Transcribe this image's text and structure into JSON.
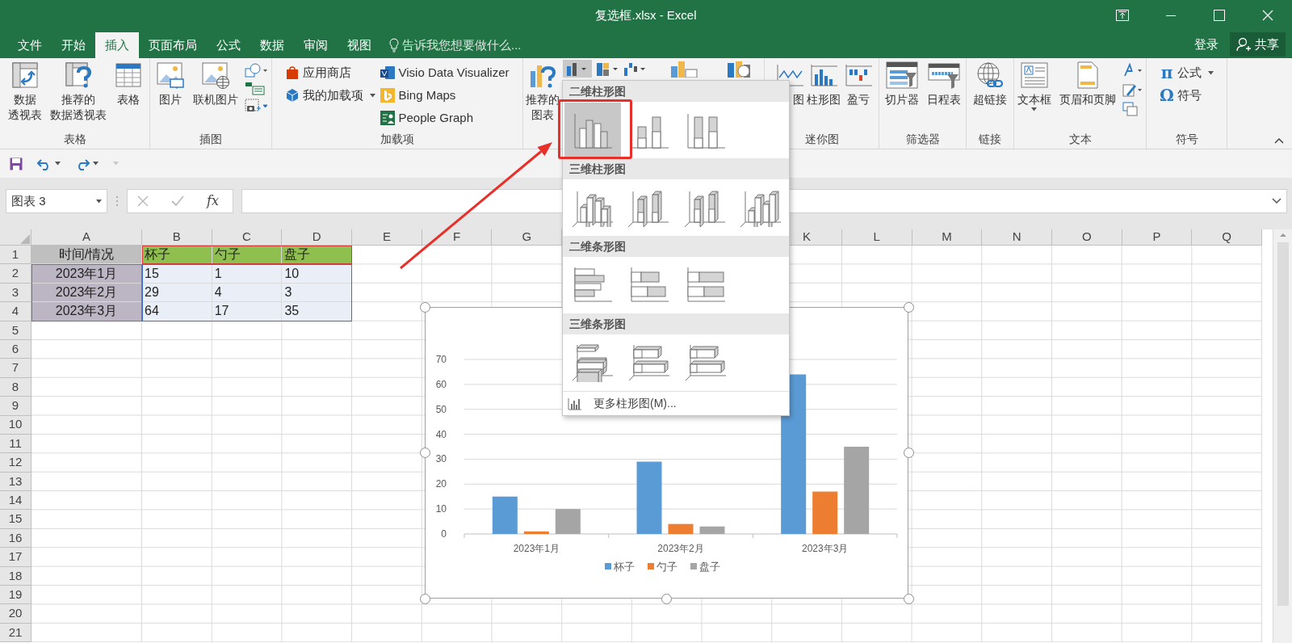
{
  "window": {
    "title": "复选框.xlsx - Excel"
  },
  "tabs": [
    {
      "label": "文件",
      "selected": false
    },
    {
      "label": "开始",
      "selected": false
    },
    {
      "label": "插入",
      "selected": true
    },
    {
      "label": "页面布局",
      "selected": false
    },
    {
      "label": "公式",
      "selected": false
    },
    {
      "label": "数据",
      "selected": false
    },
    {
      "label": "审阅",
      "selected": false
    },
    {
      "label": "视图",
      "selected": false
    }
  ],
  "tell_me": {
    "placeholder": "告诉我您想要做什么..."
  },
  "account": {
    "sign_in": "登录",
    "share": "共享"
  },
  "ribbon": {
    "groups": [
      {
        "label": "表格",
        "items": [
          {
            "kind": "large",
            "lines": [
              "数据",
              "透视表"
            ]
          },
          {
            "kind": "large",
            "lines": [
              "推荐的",
              "数据透视表"
            ]
          },
          {
            "kind": "large",
            "lines": [
              "表格"
            ]
          }
        ]
      },
      {
        "label": "插图",
        "items": [
          {
            "kind": "large",
            "lines": [
              "图片"
            ]
          },
          {
            "kind": "large",
            "lines": [
              "联机图片"
            ]
          },
          {
            "kind": "icons"
          }
        ]
      },
      {
        "label": "加载项",
        "items": [
          {
            "kind": "stack",
            "entries": [
              {
                "label": "应用商店",
                "dropdown": false
              },
              {
                "label": "我的加载项",
                "dropdown": true
              }
            ]
          },
          {
            "kind": "stack",
            "entries": [
              {
                "label": "Visio Data Visualizer",
                "dropdown": false
              },
              {
                "label": "Bing Maps",
                "dropdown": false
              },
              {
                "label": "People Graph",
                "dropdown": false
              }
            ]
          }
        ]
      },
      {
        "items": [
          {
            "kind": "large",
            "lines": [
              "推荐的",
              "图表"
            ]
          },
          {
            "kind": "icons"
          }
        ]
      },
      {
        "label": "迷你图",
        "items": [
          {
            "kind": "large",
            "lines": [
              "图"
            ]
          },
          {
            "kind": "large",
            "lines": [
              "柱形图"
            ]
          },
          {
            "kind": "large",
            "lines": [
              "盈亏"
            ]
          }
        ]
      },
      {
        "label": "筛选器",
        "items": [
          {
            "kind": "large",
            "lines": [
              "切片器"
            ]
          },
          {
            "kind": "large",
            "lines": [
              "日程表"
            ]
          }
        ]
      },
      {
        "label": "链接",
        "items": [
          {
            "kind": "large",
            "lines": [
              "超链接"
            ]
          }
        ]
      },
      {
        "label": "文本",
        "items": [
          {
            "kind": "large",
            "lines": [
              "文本框"
            ],
            "dropdown": true
          },
          {
            "kind": "large",
            "lines": [
              "页眉和页脚"
            ],
            "dropdown": false
          },
          {
            "kind": "icons"
          }
        ]
      },
      {
        "label": "符号",
        "items": [
          {
            "kind": "stack",
            "entries": [
              {
                "glyph": "π",
                "label": "公式",
                "dropdown": true
              },
              {
                "glyph": "Ω",
                "label": "符号",
                "dropdown": false
              }
            ]
          }
        ]
      }
    ]
  },
  "formula_bar": {
    "name_box": "图表 3",
    "function_label": "fx"
  },
  "sheet": {
    "columns": [
      {
        "label": "A"
      },
      {
        "label": "B"
      },
      {
        "label": "C"
      },
      {
        "label": "D"
      },
      {
        "label": "E"
      },
      {
        "label": "F"
      },
      {
        "label": "G"
      },
      {
        "label": "K"
      },
      {
        "label": "L"
      },
      {
        "label": "M"
      },
      {
        "label": "N"
      },
      {
        "label": "O"
      },
      {
        "label": "P"
      },
      {
        "label": "Q"
      }
    ],
    "rows": [
      {
        "header": "1",
        "cells": [
          "时间/情况",
          "杯子",
          "勺子",
          "盘子"
        ]
      },
      {
        "header": "2",
        "cells": [
          "2023年1月",
          "15",
          "1",
          "10"
        ]
      },
      {
        "header": "3",
        "cells": [
          "2023年2月",
          "29",
          "4",
          "3"
        ]
      },
      {
        "header": "4",
        "cells": [
          "2023年3月",
          "64",
          "17",
          "35"
        ]
      },
      {
        "header": "5"
      },
      {
        "header": "6"
      },
      {
        "header": "7"
      },
      {
        "header": "8"
      },
      {
        "header": "9"
      },
      {
        "header": "10"
      },
      {
        "header": "11"
      },
      {
        "header": "12"
      },
      {
        "header": "13"
      },
      {
        "header": "14"
      },
      {
        "header": "15"
      },
      {
        "header": "16"
      },
      {
        "header": "17"
      },
      {
        "header": "18"
      },
      {
        "header": "19"
      },
      {
        "header": "20"
      },
      {
        "header": "21"
      }
    ]
  },
  "chart": {
    "chart_data": {
      "type": "bar",
      "categories": [
        "2023年1月",
        "2023年2月",
        "2023年3月"
      ],
      "series": [
        {
          "name": "杯子",
          "color": "#5b9bd5",
          "values": [
            15,
            29,
            64
          ]
        },
        {
          "name": "勺子",
          "color": "#ed7d31",
          "values": [
            1,
            4,
            17
          ]
        },
        {
          "name": "盘子",
          "color": "#a5a5a5",
          "values": [
            10,
            3,
            35
          ]
        }
      ],
      "ylim": [
        0,
        70
      ],
      "yticks": [
        0,
        10,
        20,
        30,
        40,
        50,
        60,
        70
      ],
      "grid": true,
      "legend": "bottom"
    }
  },
  "chart_menu": {
    "sections": [
      {
        "title": "二维柱形图",
        "options": [
          {
            "selected": true
          },
          {
            "selected": false
          },
          {
            "selected": false
          }
        ]
      },
      {
        "title": "三维柱形图",
        "options": [
          {
            "selected": false
          },
          {
            "selected": false
          },
          {
            "selected": false
          },
          {
            "selected": false
          }
        ]
      },
      {
        "title": "二维条形图",
        "options": [
          {
            "selected": false
          },
          {
            "selected": false
          },
          {
            "selected": false
          }
        ]
      },
      {
        "title": "三维条形图",
        "options": [
          {
            "selected": false
          },
          {
            "selected": false
          },
          {
            "selected": false
          }
        ]
      }
    ],
    "more": "更多柱形图(M)..."
  }
}
